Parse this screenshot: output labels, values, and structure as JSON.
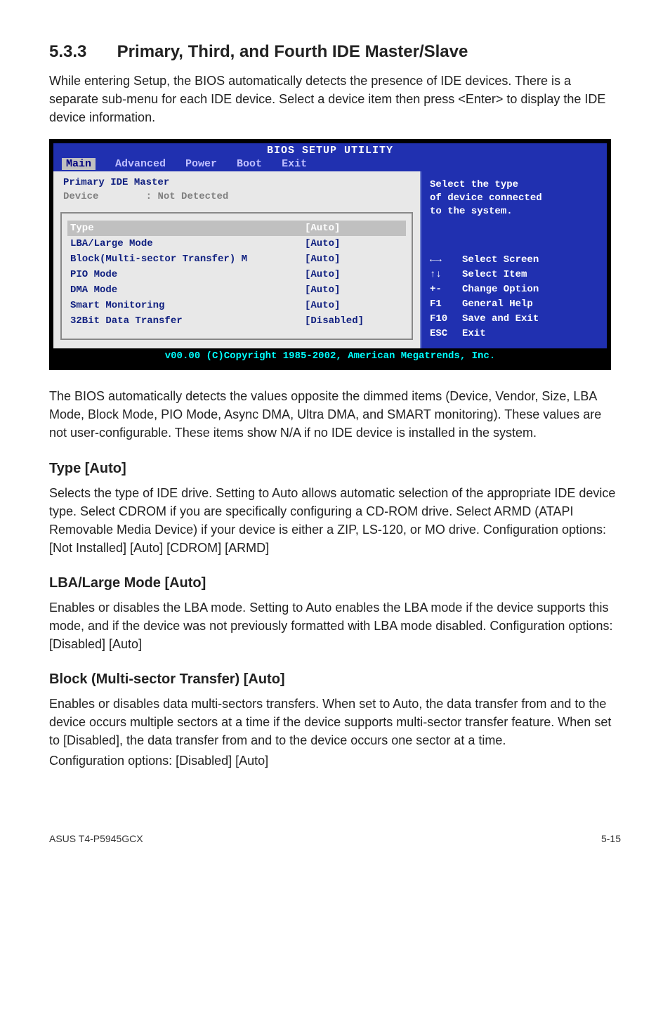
{
  "section": {
    "number": "5.3.3",
    "title": "Primary, Third, and Fourth IDE Master/Slave",
    "intro": "While entering Setup, the BIOS automatically detects the presence of IDE devices. There is a separate sub-menu for each IDE device. Select a device item then press <Enter> to display the IDE device information.",
    "after_bios": "The BIOS automatically detects the values opposite the dimmed items (Device, Vendor, Size, LBA Mode, Block Mode, PIO Mode, Async DMA, Ultra DMA, and SMART monitoring). These values are not user-configurable. These items show N/A if no IDE device is installed in the system."
  },
  "subs": {
    "type": {
      "heading": "Type [Auto]",
      "text": "Selects the type of IDE drive. Setting to Auto allows automatic selection of the appropriate IDE device type. Select CDROM if you are specifically configuring a CD-ROM drive. Select ARMD (ATAPI Removable Media Device) if your device is either a ZIP, LS-120, or MO drive. Configuration options: [Not Installed] [Auto] [CDROM] [ARMD]"
    },
    "lba": {
      "heading": "LBA/Large Mode [Auto]",
      "text": "Enables or disables the LBA mode. Setting to Auto enables the LBA mode if the device supports this mode, and if the device was not previously formatted with LBA mode disabled. Configuration options: [Disabled] [Auto]"
    },
    "block": {
      "heading": "Block (Multi-sector Transfer) [Auto]",
      "text1": "Enables or disables data multi-sectors transfers. When set to Auto, the data transfer from and to the device occurs multiple sectors at a time if the device supports multi-sector transfer feature. When set to [Disabled], the data transfer from and to the device occurs one sector at a time.",
      "text2": "Configuration options: [Disabled] [Auto]"
    }
  },
  "bios": {
    "title": "BIOS SETUP UTILITY",
    "tabs": {
      "main": "Main",
      "advanced": "Advanced",
      "power": "Power",
      "boot": "Boot",
      "exit": "Exit"
    },
    "left_header": "Primary IDE Master",
    "device_label": "Device",
    "device_value": ": Not Detected",
    "rows": [
      {
        "label": "Type",
        "value": "[Auto]",
        "selected": true
      },
      {
        "label": "LBA/Large Mode",
        "value": "[Auto]",
        "selected": false
      },
      {
        "label": "Block(Multi-sector Transfer) M",
        "value": "[Auto]",
        "selected": false
      },
      {
        "label": "PIO Mode",
        "value": "[Auto]",
        "selected": false
      },
      {
        "label": "DMA Mode",
        "value": "[Auto]",
        "selected": false
      },
      {
        "label": "Smart Monitoring",
        "value": "[Auto]",
        "selected": false
      },
      {
        "label": "32Bit Data Transfer",
        "value": "[Disabled]",
        "selected": false
      }
    ],
    "help": {
      "line1": "Select the type",
      "line2": "of device connected",
      "line3": "to the system."
    },
    "keys": [
      {
        "key": "←→",
        "act": "Select Screen"
      },
      {
        "key": "↑↓",
        "act": "Select Item"
      },
      {
        "key": "+-",
        "act": "Change Option"
      },
      {
        "key": "F1",
        "act": "General Help"
      },
      {
        "key": "F10",
        "act": "Save and Exit"
      },
      {
        "key": "ESC",
        "act": "Exit"
      }
    ],
    "footer": "v00.00 (C)Copyright 1985-2002, American Megatrends, Inc."
  },
  "footer": {
    "left": "ASUS T4-P5945GCX",
    "right": "5-15"
  }
}
